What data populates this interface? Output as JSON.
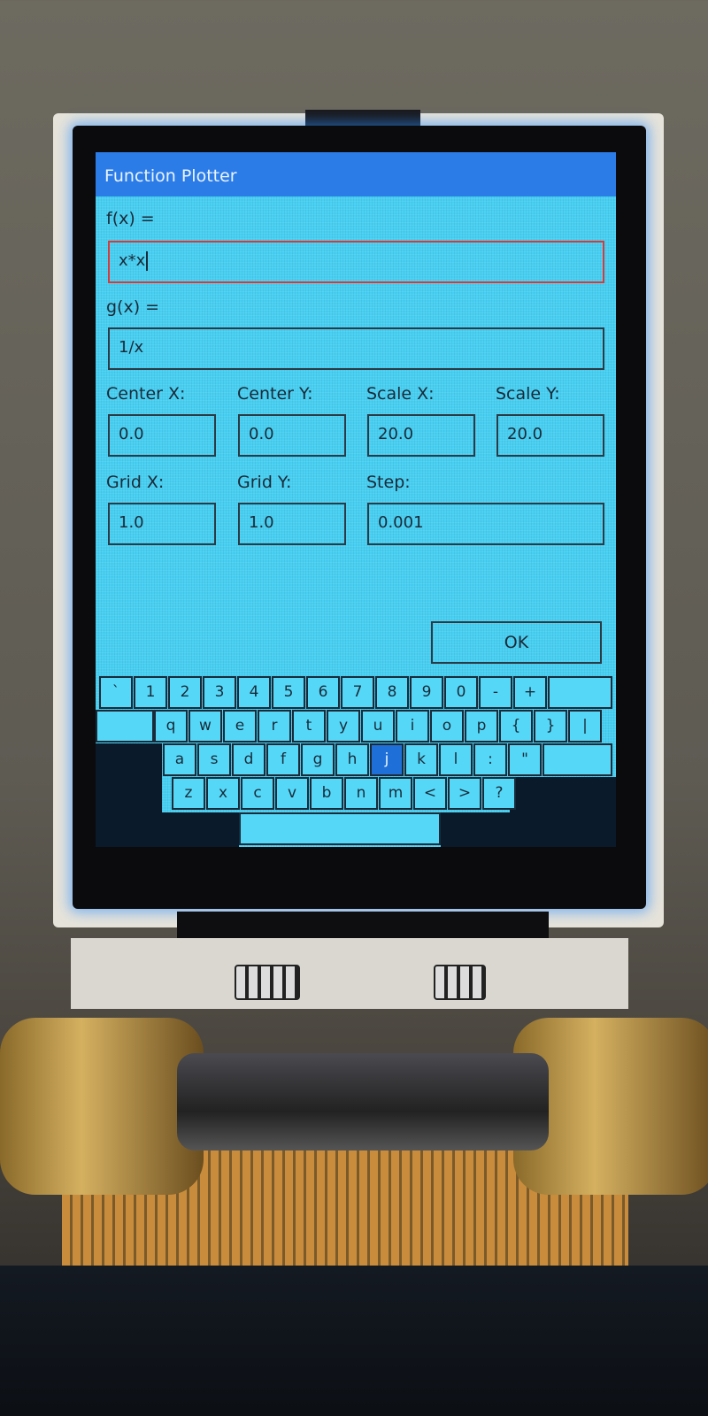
{
  "window": {
    "title": "Function Plotter"
  },
  "fields": {
    "fx": {
      "label": "f(x) =",
      "value": "x*x"
    },
    "gx": {
      "label": "g(x) =",
      "value": "1/x"
    },
    "center_x": {
      "label": "Center X:",
      "value": "0.0"
    },
    "center_y": {
      "label": "Center Y:",
      "value": "0.0"
    },
    "scale_x": {
      "label": "Scale X:",
      "value": "20.0"
    },
    "scale_y": {
      "label": "Scale Y:",
      "value": "20.0"
    },
    "grid_x": {
      "label": "Grid X:",
      "value": "1.0"
    },
    "grid_y": {
      "label": "Grid Y:",
      "value": "1.0"
    },
    "step": {
      "label": "Step:",
      "value": "0.001"
    }
  },
  "ok_label": "OK",
  "keyboard": {
    "selected_key": "j",
    "rows": [
      [
        "`",
        "1",
        "2",
        "3",
        "4",
        "5",
        "6",
        "7",
        "8",
        "9",
        "0",
        "-",
        "+"
      ],
      [
        "q",
        "w",
        "e",
        "r",
        "t",
        "y",
        "u",
        "i",
        "o",
        "p",
        "{",
        "}",
        "|"
      ],
      [
        "a",
        "s",
        "d",
        "f",
        "g",
        "h",
        "j",
        "k",
        "l",
        ":",
        "\""
      ],
      [
        "z",
        "x",
        "c",
        "v",
        "b",
        "n",
        "m",
        "<",
        ">",
        "?"
      ]
    ]
  },
  "colors": {
    "screen_bg": "#47cff2",
    "titlebar": "#2c7ce8",
    "active_field_border": "#d83a3a",
    "selected_key": "#1f6fd8"
  }
}
